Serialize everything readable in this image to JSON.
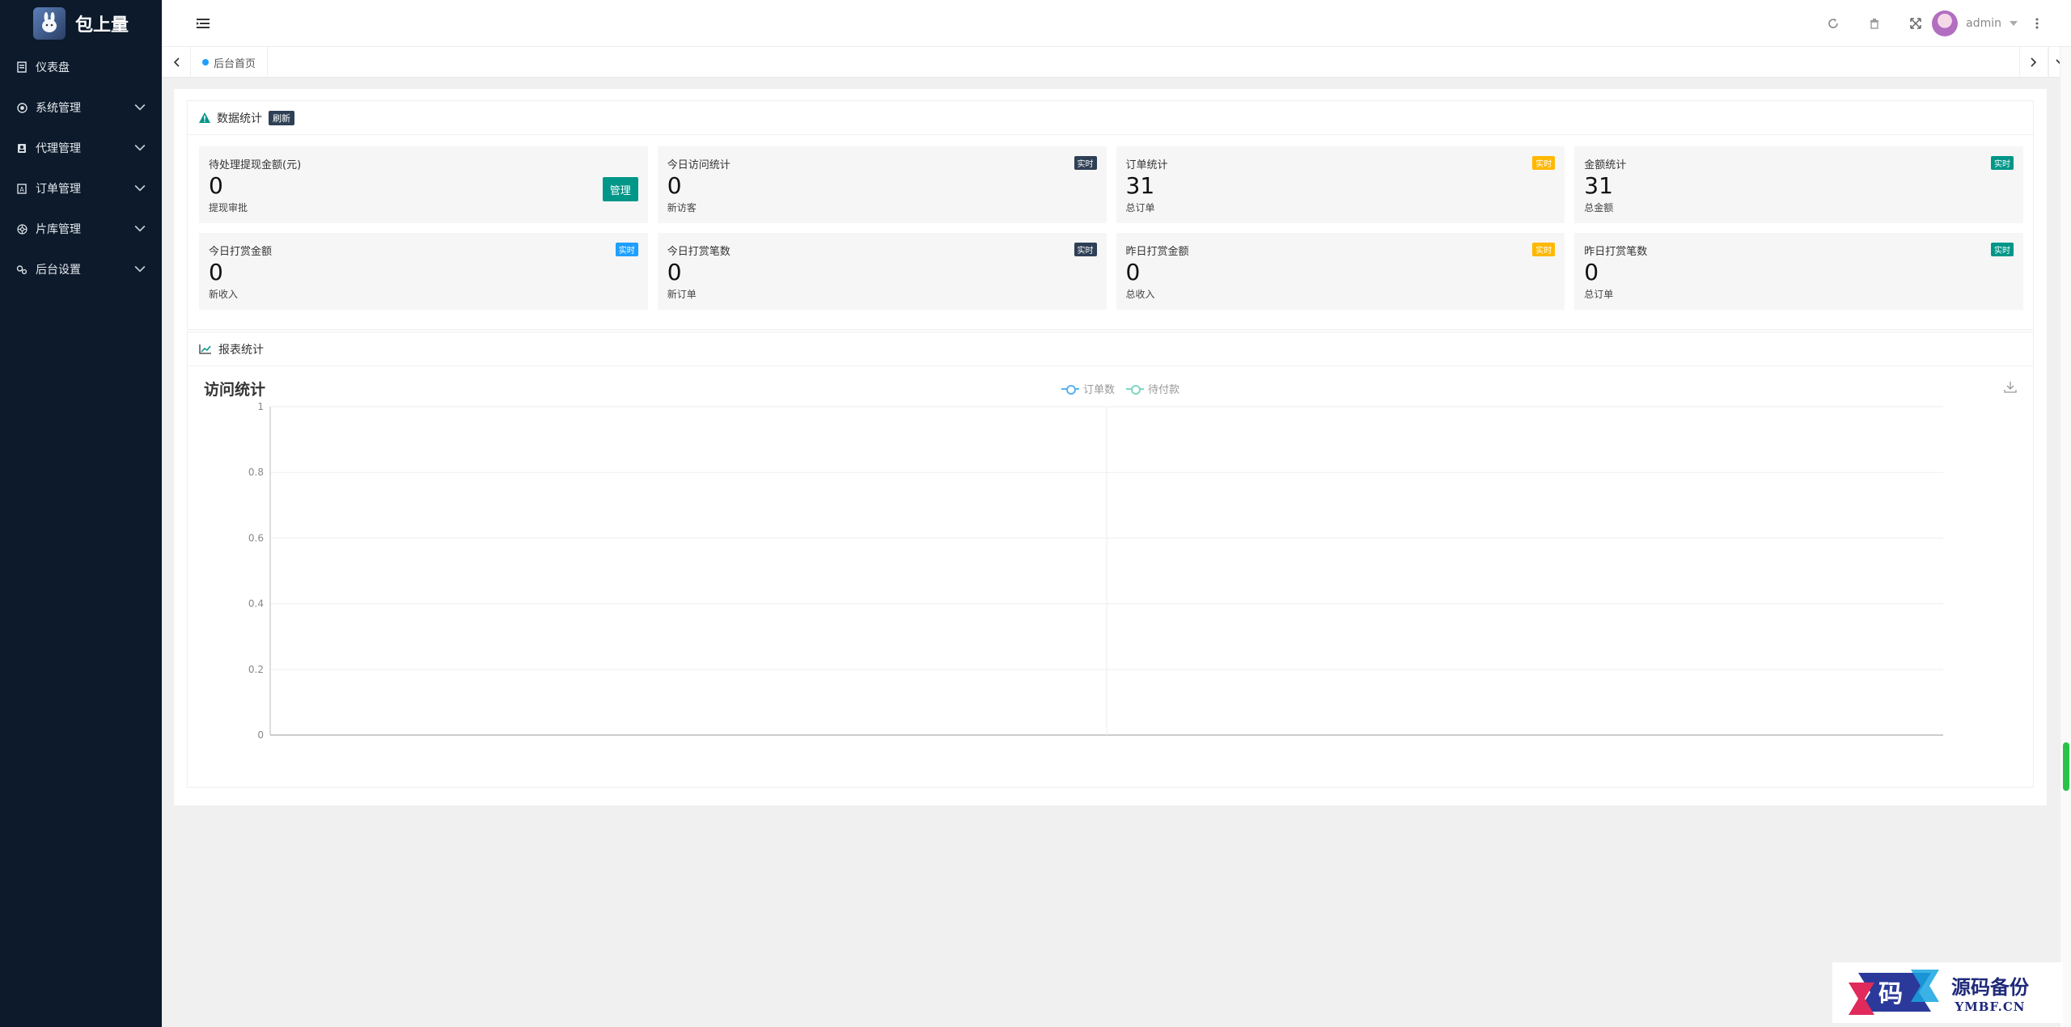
{
  "app": {
    "name": "包上量"
  },
  "sidebar": {
    "items": [
      {
        "label": "仪表盘",
        "icon": "dashboard-icon",
        "expandable": false
      },
      {
        "label": "系统管理",
        "icon": "system-icon",
        "expandable": true
      },
      {
        "label": "代理管理",
        "icon": "agent-icon",
        "expandable": true
      },
      {
        "label": "订单管理",
        "icon": "order-icon",
        "expandable": true
      },
      {
        "label": "片库管理",
        "icon": "library-icon",
        "expandable": true
      },
      {
        "label": "后台设置",
        "icon": "settings-icon",
        "expandable": true
      }
    ]
  },
  "header": {
    "user": "admin"
  },
  "tabs": {
    "home": "后台首页"
  },
  "stats_card": {
    "title": "数据统计",
    "badge": "刷新",
    "cards": [
      {
        "title": "待处理提现金额(元)",
        "value": "0",
        "sub": "提现审批",
        "button": "管理"
      },
      {
        "title": "今日访问统计",
        "value": "0",
        "sub": "新访客",
        "badge": "实时",
        "badge_color": "#2f4056"
      },
      {
        "title": "订单统计",
        "value": "31",
        "sub": "总订单",
        "badge": "实时",
        "badge_color": "#ffb800"
      },
      {
        "title": "金额统计",
        "value": "31",
        "sub": "总金额",
        "badge": "实时",
        "badge_color": "#009688"
      },
      {
        "title": "今日打赏金额",
        "value": "0",
        "sub": "新收入",
        "badge": "实时",
        "badge_color": "#1e9fff"
      },
      {
        "title": "今日打赏笔数",
        "value": "0",
        "sub": "新订单",
        "badge": "实时",
        "badge_color": "#2f4056"
      },
      {
        "title": "昨日打赏金额",
        "value": "0",
        "sub": "总收入",
        "badge": "实时",
        "badge_color": "#ffb800"
      },
      {
        "title": "昨日打赏笔数",
        "value": "0",
        "sub": "总订单",
        "badge": "实时",
        "badge_color": "#009688"
      }
    ]
  },
  "report_card": {
    "title": "报表统计"
  },
  "chart_data": {
    "type": "line",
    "title": "访问统计",
    "series": [
      {
        "name": "订单数",
        "color": "#5ab1ef",
        "values": []
      },
      {
        "name": "待付款",
        "color": "#7fd6c5",
        "values": []
      }
    ],
    "ylim": [
      0,
      1
    ],
    "yticks": [
      "0",
      "0.2",
      "0.4",
      "0.6",
      "0.8",
      "1"
    ],
    "grid": true,
    "legend": "top-center"
  },
  "watermark": {
    "main": "源码备份",
    "sub": "YMBF.CN",
    "logo_char": "码"
  }
}
